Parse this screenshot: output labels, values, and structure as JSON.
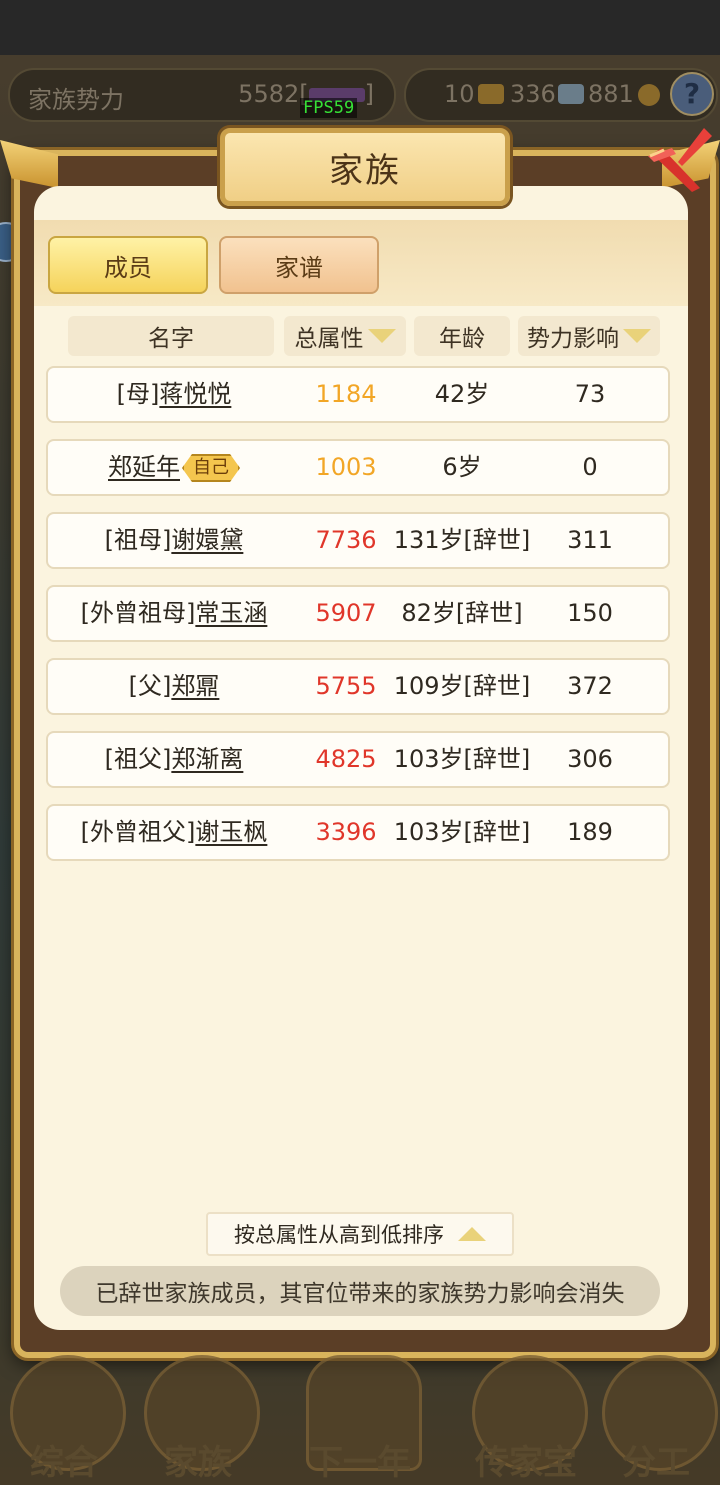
{
  "overlay_hud": {
    "fps": "FPS59",
    "family_power_label": "家族势力",
    "family_power_value": "5582[",
    "family_power_close": "]",
    "resources": [
      {
        "name": "gold-bar-icon",
        "value": "10"
      },
      {
        "name": "silver-bar-icon",
        "value": "336"
      },
      {
        "name": "coin-icon",
        "value": "881"
      }
    ],
    "help_symbol": "?"
  },
  "dialog": {
    "title": "家族",
    "tabs": [
      {
        "label": "成员",
        "active": true
      },
      {
        "label": "家谱",
        "active": false
      }
    ],
    "columns": [
      {
        "label": "名字",
        "sortable": false
      },
      {
        "label": "总属性",
        "sortable": true
      },
      {
        "label": "年龄",
        "sortable": false
      },
      {
        "label": "势力影响",
        "sortable": true
      }
    ],
    "members": [
      {
        "relation": "[母]",
        "name": "蒋悦悦",
        "is_self": false,
        "total_attr": "1184",
        "age": "42岁",
        "influence": "73"
      },
      {
        "relation": "",
        "name": "郑延年",
        "is_self": true,
        "self_tag": "自己",
        "total_attr": "1003",
        "age": "6岁",
        "influence": "0"
      },
      {
        "relation": "[祖母]",
        "name": "谢嬛黛",
        "is_self": false,
        "total_attr": "7736",
        "age": "131岁[辞世]",
        "influence": "311"
      },
      {
        "relation": "[外曾祖母]",
        "name": "常玉涵",
        "is_self": false,
        "total_attr": "5907",
        "age": "82岁[辞世]",
        "influence": "150"
      },
      {
        "relation": "[父]",
        "name": "郑鼏",
        "is_self": false,
        "total_attr": "5755",
        "age": "109岁[辞世]",
        "influence": "372"
      },
      {
        "relation": "[祖父]",
        "name": "郑渐离",
        "is_self": false,
        "total_attr": "4825",
        "age": "103岁[辞世]",
        "influence": "306"
      },
      {
        "relation": "[外曾祖父]",
        "name": "谢玉枫",
        "is_self": false,
        "total_attr": "3396",
        "age": "103岁[辞世]",
        "influence": "189"
      }
    ],
    "sort_button": "按总属性从高到低排序",
    "notice": "已辞世家族成员，其官位带来的家族势力影响会消失"
  },
  "bottom_nav": [
    "综合",
    "家族",
    "下一年",
    "传家宝",
    "分工"
  ],
  "colors": {
    "attr_living": "#f2a626",
    "attr_deceased": "#e0362a",
    "frame_gold": "#d9b45c",
    "panel_bg": "#fbf4df"
  }
}
